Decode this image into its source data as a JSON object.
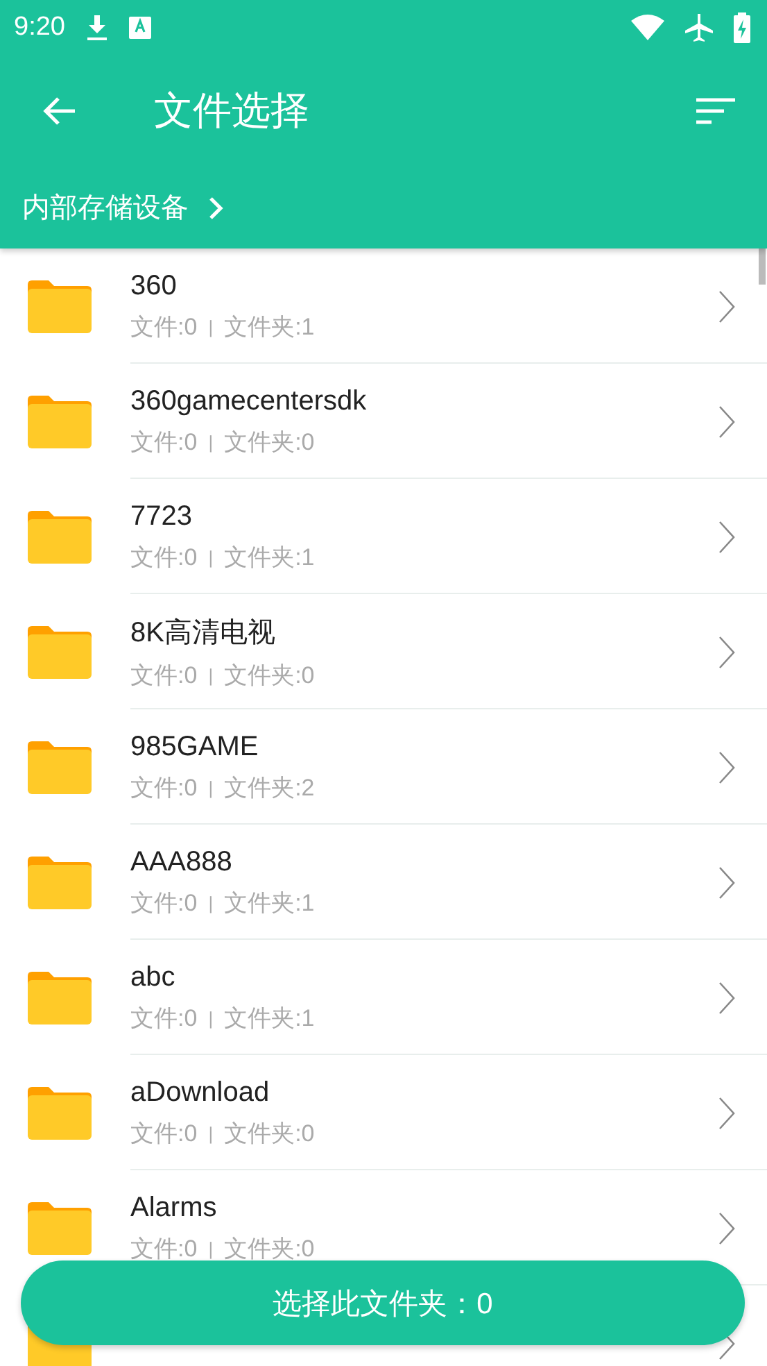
{
  "status_bar": {
    "time": "9:20"
  },
  "toolbar": {
    "title": "文件选择"
  },
  "breadcrumb": {
    "label": "内部存储设备"
  },
  "folders": [
    {
      "kind": "folder",
      "name": "360",
      "files": "文件:0",
      "separator": "|",
      "subfolders": "文件夹:1"
    },
    {
      "kind": "folder",
      "name": "360gamecentersdk",
      "files": "文件:0",
      "separator": "|",
      "subfolders": "文件夹:0"
    },
    {
      "kind": "folder",
      "name": "7723",
      "files": "文件:0",
      "separator": "|",
      "subfolders": "文件夹:1"
    },
    {
      "kind": "folder",
      "name": "8K高清电视",
      "files": "文件:0",
      "separator": "|",
      "subfolders": "文件夹:0"
    },
    {
      "kind": "folder",
      "name": "985GAME",
      "files": "文件:0",
      "separator": "|",
      "subfolders": "文件夹:2"
    },
    {
      "kind": "folder",
      "name": "AAA888",
      "files": "文件:0",
      "separator": "|",
      "subfolders": "文件夹:1"
    },
    {
      "kind": "folder",
      "name": "abc",
      "files": "文件:0",
      "separator": "|",
      "subfolders": "文件夹:1"
    },
    {
      "kind": "folder",
      "name": "aDownload",
      "files": "文件:0",
      "separator": "|",
      "subfolders": "文件夹:0"
    },
    {
      "kind": "folder",
      "name": "Alarms",
      "files": "文件:0",
      "separator": "|",
      "subfolders": "文件夹:0"
    },
    {
      "kind": "partial"
    }
  ],
  "select_button": {
    "label": "选择此文件夹：0"
  }
}
